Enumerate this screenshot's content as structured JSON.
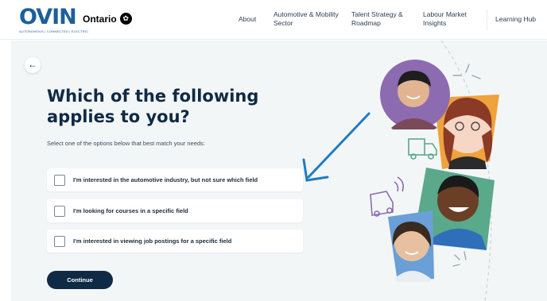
{
  "header": {
    "logo_text": "OVIN",
    "logo_tagline": "AUTONOMOUS | CONNECTED | ELECTRIC",
    "ontario_label": "Ontario",
    "nav": [
      {
        "label": "About"
      },
      {
        "label": "Automotive & Mobility Sector"
      },
      {
        "label": "Talent Strategy & Roadmap"
      },
      {
        "label": "Labour Market Insights"
      },
      {
        "label": "Learning Hub"
      }
    ]
  },
  "main": {
    "back_icon": "arrow-left-icon",
    "title": "Which of the following applies to you?",
    "subtitle": "Select one of the options below that best match your needs:",
    "options": [
      {
        "label": "I'm interested in the automotive industry, but not sure which field",
        "checked": false
      },
      {
        "label": "I'm looking for courses in a specific field",
        "checked": false
      },
      {
        "label": "I'm interested in viewing job postings for a specific field",
        "checked": false
      }
    ],
    "continue_label": "Continue"
  },
  "illustration": {
    "icons": [
      "arrow-pointer-icon",
      "truck-icon",
      "car-icon",
      "sparkle-icon"
    ],
    "photos": [
      "person-photo-man",
      "person-photo-woman-glasses",
      "person-photo-child",
      "person-photo-woman"
    ],
    "colors": {
      "purple": "#8c6bb1",
      "orange": "#f0a23c",
      "green": "#5aa98a",
      "blue": "#6a9fd8",
      "arrow": "#1f7bc4"
    }
  },
  "colors": {
    "navy": "#0f2a44",
    "panel_bg": "#f3f6f7",
    "logo_blue": "#1c5f9c"
  }
}
